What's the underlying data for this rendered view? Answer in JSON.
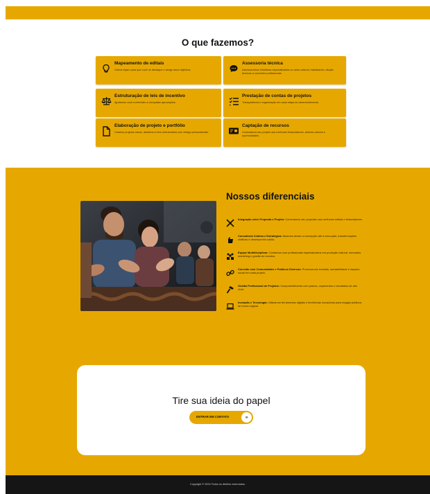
{
  "services": {
    "title": "O que fazemos?",
    "cards": [
      {
        "icon": "lightbulb-icon",
        "title": "Mapeamento de editais",
        "desc": "Outros sejam para que você os destaque e abrigo seus objetivos."
      },
      {
        "icon": "chat-icon",
        "title": "Assessoria técnica",
        "desc": "Assessoramos iniciativas especializadas no setor cultural, trabalhando, dicção técnicas a conexões profissionais."
      },
      {
        "icon": "scales-icon",
        "title": "Estruturação de leis de incentivo",
        "desc": "Ajudamos você a entender a conquistar aprovações."
      },
      {
        "icon": "checklist-icon",
        "title": "Prestação de contas de projetos",
        "desc": "Transparência e organização em cada etapa do desenvolvimento."
      },
      {
        "icon": "document-icon",
        "title": "Elaboração de projeto e portfólio",
        "desc": "Criamos projetos claros, atrativos e bem estruturados com design personalizado."
      },
      {
        "icon": "money-icon",
        "title": "Captação de recursos",
        "desc": "Conectamos seu projeto aos melhores financiadores, abrindo valores e oportunidades."
      }
    ]
  },
  "differentials": {
    "title": "Nossos diferenciais",
    "items": [
      {
        "icon": "puzzle-icon",
        "title": "Integração entre Proposta e Projeto:",
        "text": "Conectamos seu propósito aos melhores editais e financiadores."
      },
      {
        "icon": "hand-icon",
        "title": "Consultoria Criativa e Estratégica:",
        "text": "Atuamos desde a concepção até a execução, transformações criativas e desempenho sólido."
      },
      {
        "icon": "team-icon",
        "title": "Equipe Multidisciplinar:",
        "text": "Contamos com profissionais especializados em produção cultural, mercados, marketing e gestão de eventos."
      },
      {
        "icon": "link-icon",
        "title": "Conexão com Comunidades e Públicos Diversos:",
        "text": "Promovemos inclusão, acessibilidade e impacto social em cada projeto."
      },
      {
        "icon": "hammer-icon",
        "title": "Gestão Profissional de Projetos:",
        "text": "Comprometimento com prazos, orçamentos e resultados de alto nível."
      },
      {
        "icon": "laptop-icon",
        "title": "Inovação e Tecnologia:",
        "text": "Utilizamos ferramentas digitais e tendências inovadoras para engajar públicos de forma original."
      }
    ]
  },
  "cta": {
    "title": "Tire sua ideia do papel",
    "button_label": "ENTRAR EM CONTATO",
    "button_arrow": "»"
  },
  "footer": {
    "copyright": "Copyright © 2024 Todos os direitos reservados."
  },
  "colors": {
    "accent": "#e6a800",
    "dark": "#151515"
  }
}
